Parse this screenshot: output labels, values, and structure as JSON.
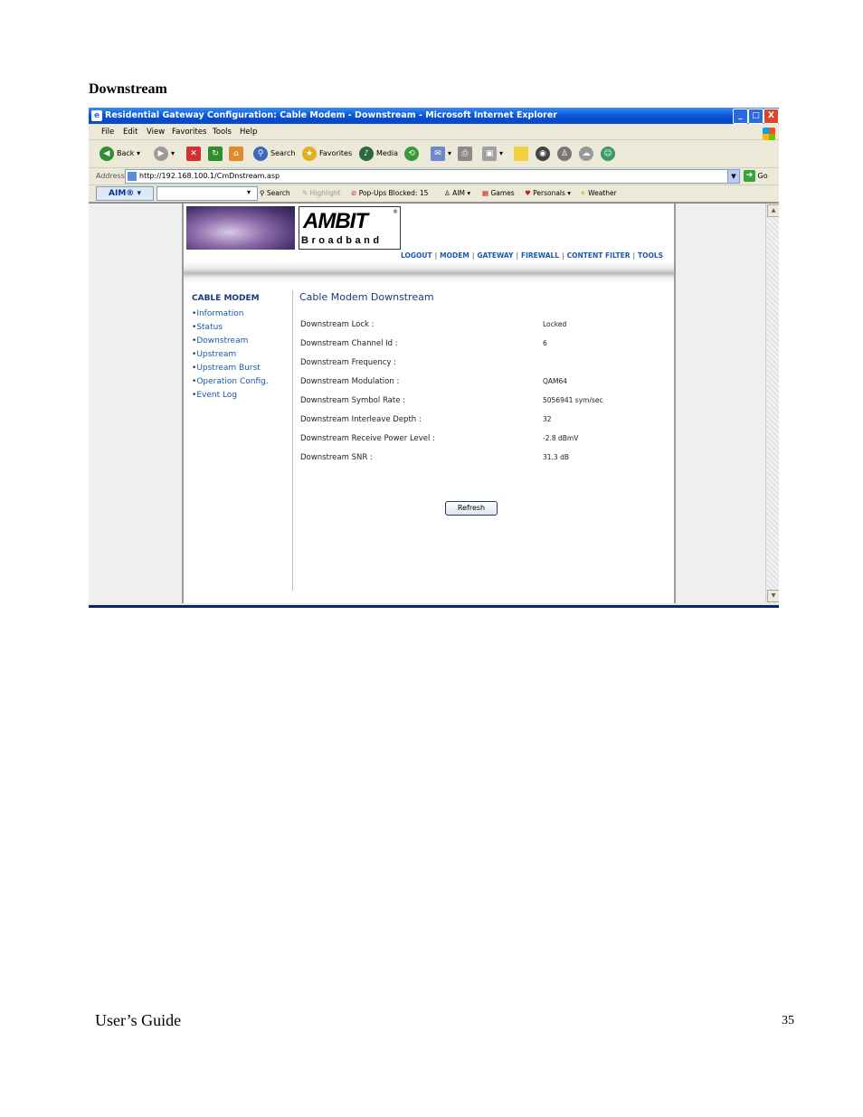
{
  "document": {
    "heading": "Downstream",
    "footer_left": "User’s Guide",
    "page_number": "35"
  },
  "window": {
    "title": "Residential Gateway Configuration: Cable Modem - Downstream - Microsoft Internet Explorer",
    "controls": {
      "minimize": "_",
      "maximize": "□",
      "close": "X"
    }
  },
  "menu": [
    "File",
    "Edit",
    "View",
    "Favorites",
    "Tools",
    "Help"
  ],
  "toolbar": {
    "back": "Back",
    "search": "Search",
    "favorites": "Favorites",
    "media": "Media"
  },
  "address": {
    "label": "Address",
    "url": "http://192.168.100.1/CmDnstream.asp",
    "go": "Go"
  },
  "aimbar": {
    "aim_label": "AIM®",
    "search": "Search",
    "highlight": "Highlight",
    "popups": "Pop-Ups Blocked: 15",
    "aim": "AIM",
    "games": "Games",
    "personals": "Personals",
    "weather": "Weather"
  },
  "brand": {
    "name": "AMBIT",
    "sub": "Broadband",
    "reg": "®"
  },
  "topnav": [
    "LOGOUT",
    "MODEM",
    "GATEWAY",
    "FIREWALL",
    "CONTENT FILTER",
    "TOOLS"
  ],
  "sidebar": {
    "heading": "CABLE MODEM",
    "items": [
      "Information",
      "Status",
      "Downstream",
      "Upstream",
      "Upstream Burst",
      "Operation Config.",
      "Event Log"
    ]
  },
  "main": {
    "title": "Cable Modem Downstream",
    "rows": [
      {
        "label": "Downstream Lock :",
        "value": "Locked"
      },
      {
        "label": "Downstream Channel Id :",
        "value": "6"
      },
      {
        "label": "Downstream Frequency :",
        "value": ""
      },
      {
        "label": "Downstream Modulation :",
        "value": "QAM64"
      },
      {
        "label": "Downstream Symbol Rate :",
        "value": "5056941 sym/sec"
      },
      {
        "label": "Downstream Interleave Depth :",
        "value": "32"
      },
      {
        "label": "Downstream Receive Power Level :",
        "value": "-2.8 dBmV"
      },
      {
        "label": "Downstream SNR :",
        "value": "31.3 dB"
      }
    ],
    "refresh_label": "Refresh"
  }
}
